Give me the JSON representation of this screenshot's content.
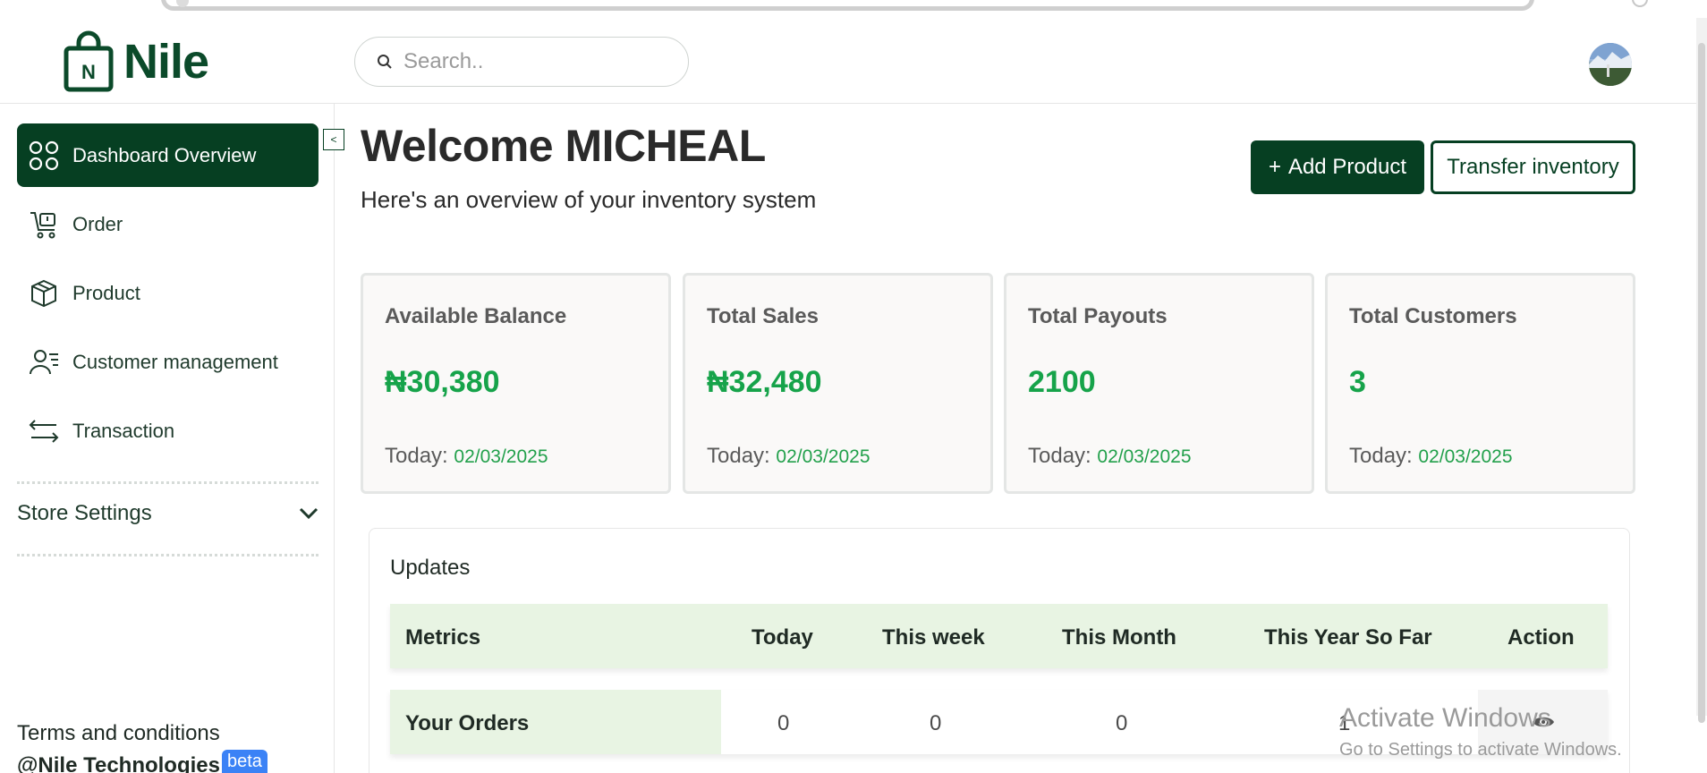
{
  "brand": {
    "name": "Nile",
    "logo_letter": "N"
  },
  "search": {
    "placeholder": "Search.."
  },
  "sidebar": {
    "items": [
      {
        "label": "Dashboard Overview",
        "icon": "grid-icon",
        "active": true
      },
      {
        "label": "Order",
        "icon": "cart-icon",
        "active": false
      },
      {
        "label": "Product",
        "icon": "box-icon",
        "active": false
      },
      {
        "label": "Customer management",
        "icon": "users-icon",
        "active": false
      },
      {
        "label": "Transaction",
        "icon": "transfer-arrows-icon",
        "active": false
      }
    ],
    "collapse_glyph": "<",
    "store_settings_label": "Store Settings",
    "terms_label": "Terms and conditions",
    "copyright_label": "@Nile Technologies",
    "beta_label": "beta"
  },
  "main": {
    "welcome": "Welcome MICHEAL",
    "subtitle": "Here's an overview of your inventory system",
    "add_product_label": "Add Product",
    "add_product_plus": "+",
    "transfer_label": "Transfer inventory"
  },
  "cards": [
    {
      "title": "Available Balance",
      "value": "₦30,380",
      "date_prefix": "Today:",
      "date": "02/03/2025"
    },
    {
      "title": "Total Sales",
      "value": "₦32,480",
      "date_prefix": "Today:",
      "date": "02/03/2025"
    },
    {
      "title": "Total Payouts",
      "value": "2100",
      "date_prefix": "Today:",
      "date": "02/03/2025"
    },
    {
      "title": "Total Customers",
      "value": "3",
      "date_prefix": "Today:",
      "date": "02/03/2025"
    }
  ],
  "updates": {
    "title": "Updates",
    "columns": [
      "Metrics",
      "Today",
      "This week",
      "This Month",
      "This Year So Far",
      "Action"
    ],
    "rows": [
      {
        "metric": "Your Orders",
        "today": "0",
        "week": "0",
        "month": "0",
        "year": "1"
      }
    ]
  },
  "watermark": {
    "line1": "Activate Windows",
    "line2": "Go to Settings to activate Windows."
  },
  "colors": {
    "brand_dark_green": "#063f22",
    "value_green": "#16a34a",
    "table_header_bg": "#e8f4e3",
    "beta_blue": "#3b82f6"
  }
}
